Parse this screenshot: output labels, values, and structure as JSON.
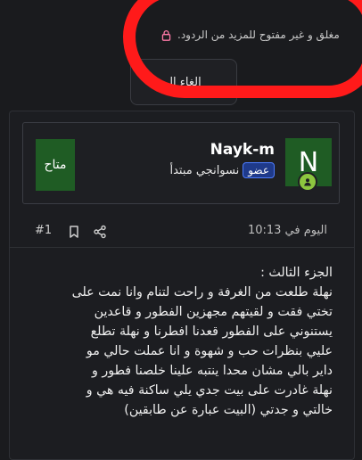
{
  "notice": {
    "text": "مغلق و غير مفتوح للمزيد من الردود."
  },
  "action_button": {
    "label": "إلغاء الـ"
  },
  "post": {
    "author": {
      "avatar_letter": "N",
      "username": "Nayk-m",
      "title": "نسوانجي مبتدأ",
      "badge": "عضو",
      "status": "متاح"
    },
    "date": "اليوم في 10:13",
    "number": "#1",
    "body_lines": [
      "الجزء الثالث :",
      "نهلة طلعت من الغرفة و راحت لتنام وانا نمت على",
      "تختي فقت و لقيتهم مجهزين الفطور و قاعدين",
      "يستنوني على الفطور قعدنا افطرنا و نهلة تطلع",
      "عليي بنظرات حب و شهوة و انا عملت حالي مو",
      "داير بالي مشان محدا ينتبه علينا خلصنا فطور و",
      "نهلة غادرت على بيت جدي يلي ساكنة فيه هي و",
      "خالتي و جدتي (البيت عبارة عن طابقين)"
    ]
  },
  "colors": {
    "highlight": "#ff1a1a",
    "avatar_bg": "#1f5c24",
    "badge_bg": "#1f3a8a"
  }
}
